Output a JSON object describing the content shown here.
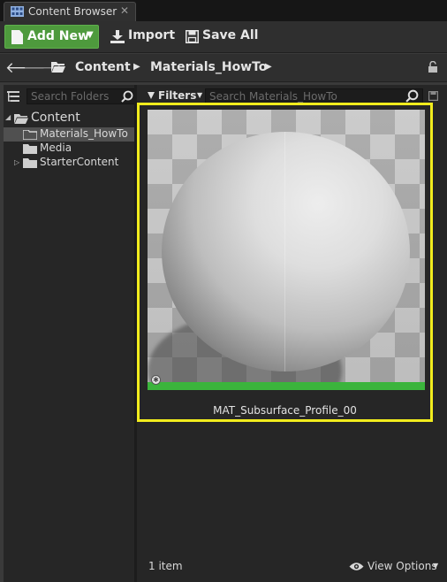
{
  "window": {
    "tab_title": "Content Browser",
    "close_glyph": "✕"
  },
  "toolbar": {
    "add_new_label": "Add New",
    "import_label": "Import",
    "save_all_label": "Save All"
  },
  "path": {
    "back_glyph": "🡐",
    "forward_glyph": "🡒",
    "crumbs": [
      "Content",
      "Materials_HowTo"
    ],
    "separator_glyph": "▶"
  },
  "folders": {
    "search_placeholder": "Search Folders",
    "tree": [
      {
        "label": "Content",
        "expanded": true,
        "selected": false
      },
      {
        "label": "Materials_HowTo",
        "expanded": false,
        "selected": true
      },
      {
        "label": "Media",
        "expanded": false,
        "selected": false
      },
      {
        "label": "StarterContent",
        "expanded": false,
        "selected": false
      }
    ]
  },
  "assets": {
    "filters_label": "Filters",
    "search_placeholder": "Search Materials_HowTo",
    "items": [
      {
        "name": "MAT_Subsurface_Profile_00",
        "selected": true,
        "type_bar_color": "#3bb43c"
      }
    ],
    "item_count": "1 item",
    "view_options_label": "View Options"
  },
  "colors": {
    "selection_outline": "#f1ec1d",
    "add_new_button": "#4e9a3d",
    "panel_background": "#262626"
  }
}
